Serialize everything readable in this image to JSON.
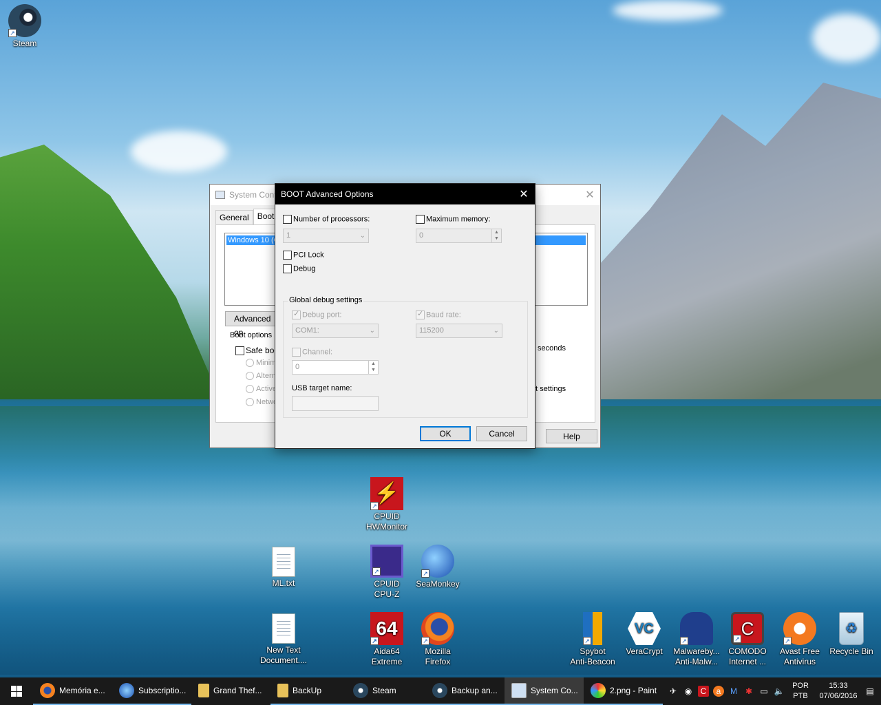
{
  "desktop": {
    "icons": {
      "steam": "Steam",
      "hwmonitor": "CPUID\nHWMonitor",
      "mltxt": "ML.txt",
      "cpuz": "CPUID\nCPU-Z",
      "seamonkey": "SeaMonkey",
      "newtext": "New Text\nDocument....",
      "aida64": "Aida64\nExtreme",
      "firefox": "Mozilla\nFirefox",
      "spybot": "Spybot\nAnti-Beacon",
      "veracrypt": "VeraCrypt",
      "malwarebytes": "Malwareby...\nAnti-Malw...",
      "comodo": "COMODO\nInternet ...",
      "avast": "Avast Free\nAntivirus",
      "recycle": "Recycle Bin"
    }
  },
  "syscfg": {
    "title": "System Conf",
    "tab_general": "General",
    "tab_boot": "Boot",
    "os_entry": "Windows 10 (C",
    "advanced_btn": "Advanced op",
    "boot_options": "Boot options",
    "safe_boot": "Safe boo",
    "minimal": "Minim",
    "alternate": "Altern",
    "active": "Active",
    "network": "Netwo",
    "seconds": "seconds",
    "boot_settings": "ot settings",
    "help_btn": "Help"
  },
  "boot": {
    "title": "BOOT Advanced Options",
    "num_processors": "Number of processors:",
    "num_processors_value": "1",
    "max_memory": "Maximum memory:",
    "max_memory_value": "0",
    "pci_lock": "PCI Lock",
    "debug": "Debug",
    "global_debug": "Global debug settings",
    "debug_port": "Debug port:",
    "debug_port_value": "COM1:",
    "baud_rate": "Baud rate:",
    "baud_rate_value": "115200",
    "channel": "Channel:",
    "channel_value": "0",
    "usb_target": "USB target name:",
    "ok": "OK",
    "cancel": "Cancel"
  },
  "taskbar": {
    "tasks": [
      "Memória e...",
      "Subscriptio...",
      "Grand Thef...",
      "BackUp",
      "Steam",
      "Backup an...",
      "System Co...",
      "2.png - Paint"
    ],
    "lang1": "POR",
    "lang2": "PTB",
    "time": "15:33",
    "date": "07/06/2016"
  },
  "colors": {
    "accent": "#0078d7",
    "selection": "#3399ff"
  }
}
